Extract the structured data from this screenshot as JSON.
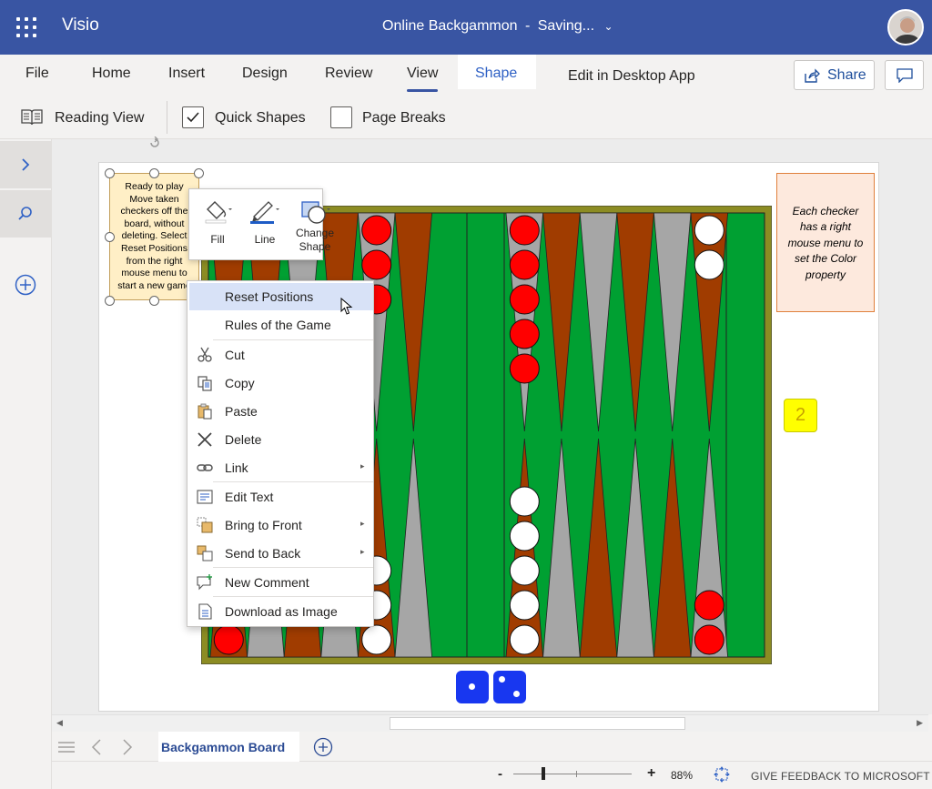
{
  "app": {
    "name": "Visio",
    "document_title": "Online Backgammon",
    "save_status": "Saving...",
    "title_separator": "-"
  },
  "ribbon": {
    "tabs": [
      "File",
      "Home",
      "Insert",
      "Design",
      "Review",
      "View",
      "Shape"
    ],
    "active_tab": "View",
    "contextual_tab": "Shape",
    "edit_desktop": "Edit in Desktop App",
    "share_label": "Share"
  },
  "commandbar": {
    "reading_view": "Reading View",
    "quick_shapes": "Quick Shapes",
    "quick_shapes_checked": true,
    "page_breaks": "Page Breaks",
    "page_breaks_checked": false
  },
  "canvas": {
    "note_left": "Ready to play\nMove taken\ncheckers off the\nboard, without\ndeleting. Select\nReset Positions\nfrom the right\nmouse menu to\nstart a new game",
    "note_right": "Each checker\nhas a right\nmouse menu to\nset the Color\nproperty",
    "doubling_cube": "2"
  },
  "mini_toolbar": {
    "fill": "Fill",
    "line": "Line",
    "change_shape_1": "Change",
    "change_shape_2": "Shape"
  },
  "context_menu": {
    "items": [
      {
        "label": "Reset Positions",
        "icon": "none",
        "highlighted": true
      },
      {
        "label": "Rules of the Game",
        "icon": "none"
      },
      {
        "label": "Cut",
        "icon": "scissors-icon"
      },
      {
        "label": "Copy",
        "icon": "copy-icon"
      },
      {
        "label": "Paste",
        "icon": "paste-icon"
      },
      {
        "label": "Delete",
        "icon": "delete-x-icon"
      },
      {
        "label": "Link",
        "icon": "link-icon",
        "submenu": true
      },
      {
        "label": "Edit Text",
        "icon": "edit-text-icon"
      },
      {
        "label": "Bring to Front",
        "icon": "bring-front-icon",
        "submenu": true
      },
      {
        "label": "Send to Back",
        "icon": "send-back-icon",
        "submenu": true
      },
      {
        "label": "New Comment",
        "icon": "comment-icon"
      },
      {
        "label": "Download as Image",
        "icon": "image-download-icon"
      }
    ]
  },
  "sheets": {
    "active": "Backgammon Board"
  },
  "status": {
    "zoom": "88%",
    "feedback": "GIVE FEEDBACK TO MICROSOFT",
    "zoom_minus": "-",
    "zoom_plus": "+"
  },
  "colors": {
    "brand": "#3955a3",
    "board_frame": "#8c8c23",
    "board_felt": "#00a032",
    "point_dark": "#a03c00",
    "point_light": "#a6a6a6",
    "checker_red": "#ff0000",
    "checker_white": "#ffffff",
    "die": "#1837f0",
    "cube": "#ffff00"
  },
  "board": {
    "top_points": [
      {
        "color": "dark",
        "checkers": "white",
        "count": 1
      },
      {
        "color": "dark",
        "checkers": "none",
        "count": 0
      },
      {
        "color": "light",
        "checkers": "none",
        "count": 0
      },
      {
        "color": "dark",
        "checkers": "none",
        "count": 0
      },
      {
        "color": "light",
        "checkers": "red",
        "count": 3
      },
      {
        "color": "dark",
        "checkers": "none",
        "count": 0
      },
      {
        "color": "light",
        "checkers": "red",
        "count": 5
      },
      {
        "color": "dark",
        "checkers": "none",
        "count": 0
      },
      {
        "color": "light",
        "checkers": "none",
        "count": 0
      },
      {
        "color": "dark",
        "checkers": "none",
        "count": 0
      },
      {
        "color": "light",
        "checkers": "none",
        "count": 0
      },
      {
        "color": "dark",
        "checkers": "white",
        "count": 2
      }
    ],
    "bottom_points": [
      {
        "color": "dark",
        "checkers": "red",
        "count": 1
      },
      {
        "color": "light",
        "checkers": "none",
        "count": 0
      },
      {
        "color": "dark",
        "checkers": "none",
        "count": 0
      },
      {
        "color": "light",
        "checkers": "none",
        "count": 0
      },
      {
        "color": "dark",
        "checkers": "white",
        "count": 3
      },
      {
        "color": "light",
        "checkers": "none",
        "count": 0
      },
      {
        "color": "dark",
        "checkers": "white",
        "count": 5
      },
      {
        "color": "light",
        "checkers": "none",
        "count": 0
      },
      {
        "color": "dark",
        "checkers": "none",
        "count": 0
      },
      {
        "color": "light",
        "checkers": "none",
        "count": 0
      },
      {
        "color": "dark",
        "checkers": "none",
        "count": 0
      },
      {
        "color": "light",
        "checkers": "red",
        "count": 2
      }
    ],
    "dice": [
      1,
      2
    ]
  }
}
